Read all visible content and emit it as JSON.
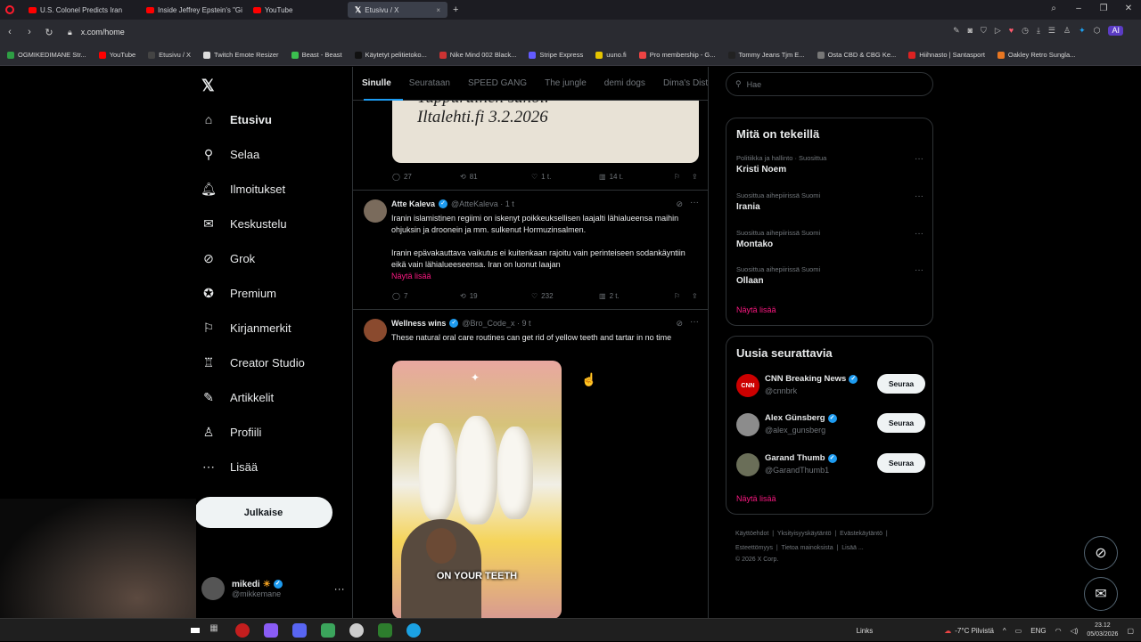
{
  "browser": {
    "tabs": [
      {
        "label": "U.S. Colonel Predicts Iran"
      },
      {
        "label": "Inside Jeffrey Epstein's \"Gi"
      },
      {
        "label": "YouTube"
      },
      {
        "label": "Etusivu / X"
      }
    ],
    "url": "x.com/home",
    "bookmarks": [
      "OGMIKEDIMANE Str...",
      "YouTube",
      "Etusivu / X",
      "Twitch Emote Resizer",
      "Beast - Beast",
      "Käytetyt pelitietoko...",
      "Nike Mind 002 Black...",
      "Stripe Express",
      "uuno.fi",
      "Pro membership - G...",
      "Tommy Jeans Tjm E...",
      "Osta CBD & CBG Ke...",
      "Hiihnasto | Santasport",
      "Oakley Retro Sungla..."
    ],
    "ai_label": "AI"
  },
  "nav": {
    "items": [
      "Etusivu",
      "Selaa",
      "Ilmoitukset",
      "Keskustelu",
      "Grok",
      "Premium",
      "Kirjanmerkit",
      "Creator Studio",
      "Artikkelit",
      "Profiili",
      "Lisää"
    ],
    "post_label": "Julkaise",
    "profile_name": "mikedi",
    "profile_handle": "@mikkemane"
  },
  "timeline": {
    "tabs": [
      "Sinulle",
      "Seurataan",
      "SPEED GANG",
      "The jungle",
      "demi dogs",
      "Dima's Dist"
    ],
    "first_image_text": [
      "Tuppurainen sanoi.",
      "Iltalehti.fi 3.2.2026"
    ],
    "first_actions": {
      "replies": "27",
      "reposts": "81",
      "likes": "1 t.",
      "views": "14 t."
    },
    "tweet2": {
      "name": "Atte Kaleva",
      "handle": "@AtteKaleva · 1 t",
      "text1": "Iranin islamistinen regiimi on iskenyt poikkeuksellisen laajalti lähialueensa maihin ohjuksin ja droonein ja mm. sulkenut Hormuzinsalmen.",
      "text2": "Iranin epävakauttava vaikutus ei kuitenkaan rajoitu vain perinteiseen sodankäyntiin eikä vain lähialueeseensa. Iran on luonut laajan",
      "show_more": "Näytä lisää",
      "replies": "7",
      "reposts": "19",
      "likes": "232",
      "views": "2 t."
    },
    "tweet3": {
      "name": "Wellness wins",
      "handle": "@Bro_Code_x · 9 t",
      "text": "These natural oral care routines  can get rid of yellow teeth and tartar in no time",
      "image_caption": "ON YOUR TEETH"
    }
  },
  "sidebar": {
    "search_placeholder": "Hae",
    "trends_title": "Mitä on tekeillä",
    "trends": [
      {
        "context": "Politiikka ja hallinto · Suosittua",
        "name": "Kristi Noem"
      },
      {
        "context": "Suosittua aihepiirissä Suomi",
        "name": "Irania"
      },
      {
        "context": "Suosittua aihepiirissä Suomi",
        "name": "Montako"
      },
      {
        "context": "Suosittua aihepiirissä Suomi",
        "name": "Ollaan"
      }
    ],
    "trends_more": "Näytä lisää",
    "follow_title": "Uusia seurattavia",
    "follows": [
      {
        "name": "CNN Breaking News",
        "handle": "@cnnbrk",
        "button": "Seuraa"
      },
      {
        "name": "Alex Günsberg",
        "handle": "@alex_gunsberg",
        "button": "Seuraa"
      },
      {
        "name": "Garand Thumb",
        "handle": "@GarandThumb1",
        "button": "Seuraa"
      }
    ],
    "follow_more": "Näytä lisää",
    "footer": [
      "Käyttöehdot",
      "Yksityisyyskäytäntö",
      "Evästekäytäntö",
      "Esteettömyys",
      "Tietoa mainoksista",
      "Lisää ...",
      "© 2026 X Corp."
    ]
  },
  "taskbar": {
    "links_label": "Links",
    "weather": "-7°C  Pilvistä",
    "lang": "ENG",
    "time": "23.12",
    "date": "05/03/2026"
  },
  "colors": {
    "accent_pink": "#f91880",
    "verified_blue": "#1d9bf0",
    "background": "#000000"
  }
}
